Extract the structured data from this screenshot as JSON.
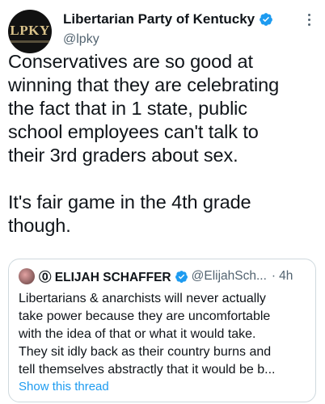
{
  "header": {
    "avatar_text": "LPKY",
    "display_name": "Libertarian Party of Kentucky",
    "handle": "@lpky",
    "verified_icon": "verified-badge-icon",
    "more_icon": "more-options-icon"
  },
  "tweet": {
    "text": "Conservatives are so good at\nwinning that they are celebrating\nthe fact that in 1 state, public\nschool employees can't talk to\ntheir 3rd graders about sex.\n\nIt's fair game in the 4th grade\nthough."
  },
  "quote": {
    "author_name": "⓪ ELIJAH SCHAFFER",
    "handle": "@ElijahSch...",
    "separator": "·",
    "time": "4h",
    "text": "Libertarians & anarchists will never actually\ntake power because they are uncomfortable\nwith the idea of that or what it would take.\nThey sit idly back as their country burns and\ntell themselves abstractly that it would be b...",
    "show_thread": "Show this thread"
  },
  "colors": {
    "text": "#0f1419",
    "secondary": "#536471",
    "link": "#1d9bf0",
    "border": "#cfd9de",
    "verified": "#1d9bf0"
  }
}
